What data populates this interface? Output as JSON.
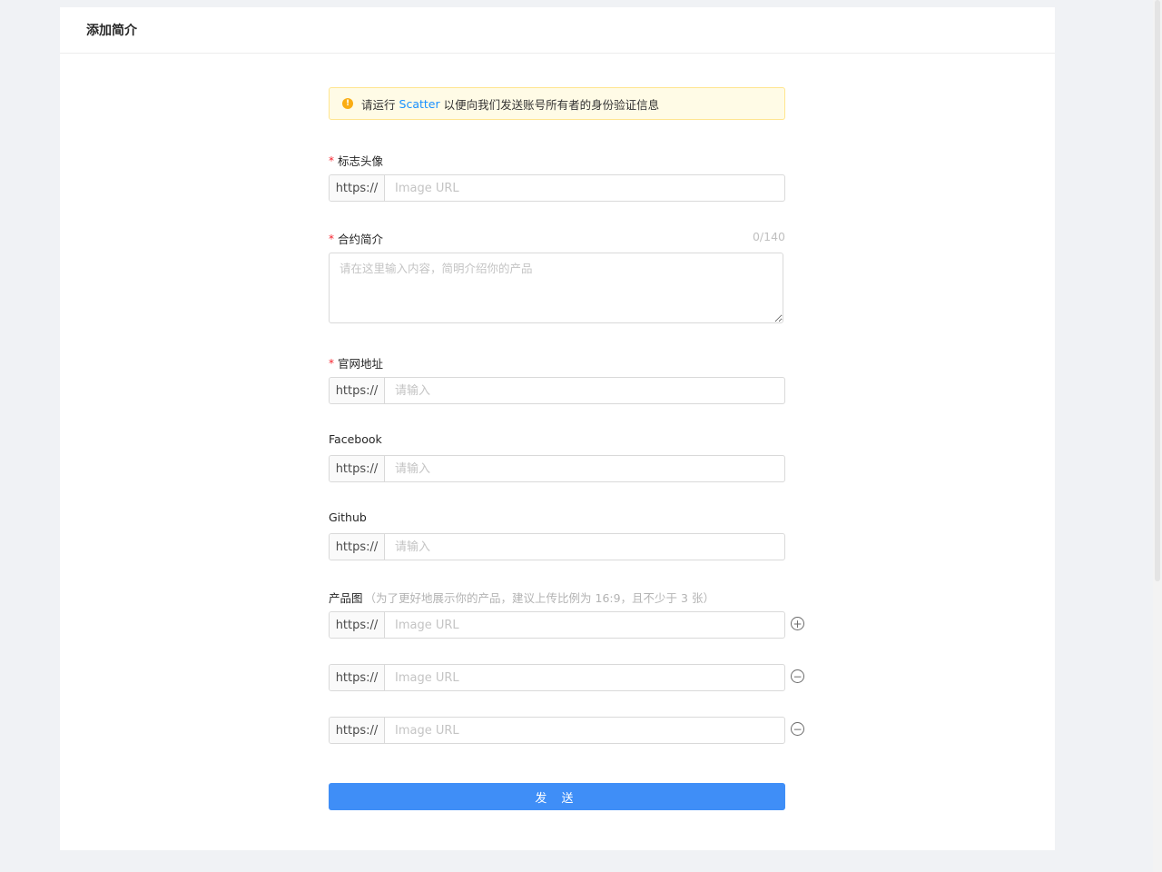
{
  "header": {
    "title": "添加简介"
  },
  "alert": {
    "prefix": "请运行",
    "link": "Scatter",
    "suffix": "以便向我们发送账号所有者的身份验证信息",
    "icon": "warning-icon"
  },
  "fields": {
    "logo": {
      "label": "标志头像",
      "required": true,
      "addon": "https://",
      "placeholder": "Image URL"
    },
    "intro": {
      "label": "合约简介",
      "required": true,
      "counter": "0/140",
      "placeholder": "请在这里输入内容，简明介绍你的产品"
    },
    "website": {
      "label": "官网地址",
      "required": true,
      "addon": "https://",
      "placeholder": "请输入"
    },
    "facebook": {
      "label": "Facebook",
      "addon": "https://",
      "placeholder": "请输入"
    },
    "github": {
      "label": "Github",
      "addon": "https://",
      "placeholder": "请输入"
    },
    "product_images": {
      "label": "产品图",
      "hint": "（为了更好地展示你的产品，建议上传比例为 16:9，且不少于 3 张）",
      "items": [
        {
          "addon": "https://",
          "placeholder": "Image URL",
          "action": "add"
        },
        {
          "addon": "https://",
          "placeholder": "Image URL",
          "action": "remove"
        },
        {
          "addon": "https://",
          "placeholder": "Image URL",
          "action": "remove"
        }
      ]
    }
  },
  "submit_label": "发 送",
  "colors": {
    "primary": "#3f8ef7",
    "link": "#1890ff",
    "alert_bg": "#fffbe6",
    "alert_border": "#ffe58f",
    "warning": "#faad14",
    "required": "#f5222d"
  }
}
